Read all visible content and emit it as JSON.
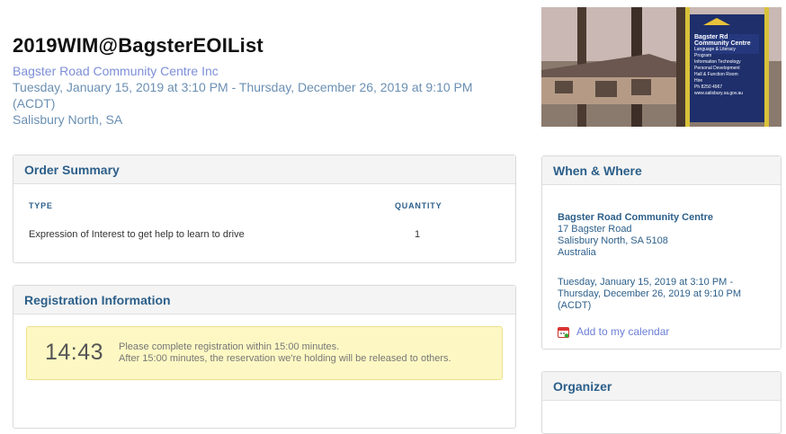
{
  "event": {
    "title": "2019WIM@BagsterEOIList",
    "organizer_name": "Bagster Road Community Centre Inc",
    "dates_line1": "Tuesday, January 15, 2019 at 3:10 PM - Thursday, December 26, 2019 at 9:10 PM",
    "dates_line2": "(ACDT)",
    "location": "Salisbury North, SA"
  },
  "photo": {
    "sign_lines": [
      "Bagster Rd",
      "Community Centre",
      "Language & Literacy",
      "Program",
      "Information Technology",
      "Personal Development",
      "Hall & Function Room",
      "Hire",
      "Ph 8250 4967",
      "www.salisbury.sa.gov.au"
    ]
  },
  "order_summary": {
    "heading": "Order Summary",
    "col_type": "TYPE",
    "col_quantity": "QUANTITY",
    "rows": [
      {
        "type": "Expression of Interest to get help to learn to drive",
        "quantity": "1"
      }
    ]
  },
  "registration": {
    "heading": "Registration Information",
    "timer": "14:43",
    "message_line1": "Please complete registration within 15:00 minutes.",
    "message_line2": "After 15:00 minutes, the reservation we're holding will be released to others."
  },
  "when_where": {
    "heading": "When & Where",
    "venue": "Bagster Road Community Centre",
    "street": "17 Bagster Road",
    "suburb": "Salisbury North, SA 5108",
    "country": "Australia",
    "date_line1": "Tuesday, January 15, 2019 at 3:10 PM -",
    "date_line2": "Thursday, December 26, 2019 at 9:10 PM",
    "date_line3": "(ACDT)",
    "calendar_link": "Add to my calendar",
    "calendar_icon": "calendar-icon"
  },
  "organizer_panel": {
    "heading": "Organizer"
  },
  "colors": {
    "heading_blue": "#2c5f8a",
    "link_purple": "#6b7fd6",
    "timer_bg": "#fdf8c3"
  }
}
